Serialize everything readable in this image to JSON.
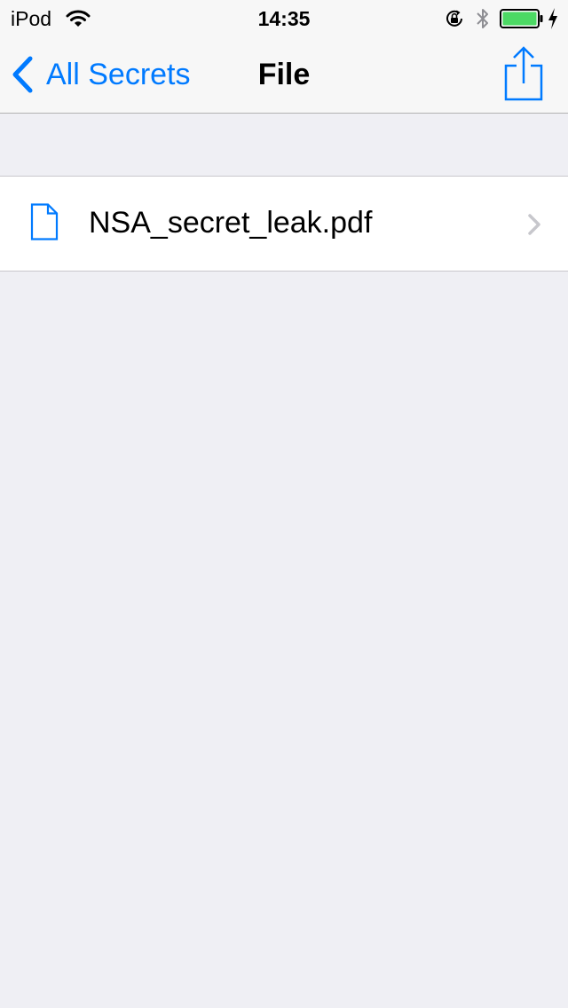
{
  "status_bar": {
    "carrier": "iPod",
    "time": "14:35",
    "icons": [
      "wifi-icon",
      "orientation-lock-icon",
      "bluetooth-icon",
      "battery-icon",
      "charging-icon"
    ],
    "battery_color": "#4cd964"
  },
  "nav": {
    "back_label": "All Secrets",
    "title": "File",
    "back_icon": "chevron-left-icon",
    "action_icon": "share-icon"
  },
  "files": [
    {
      "name": "NSA_secret_leak.pdf",
      "icon": "document-icon"
    }
  ],
  "colors": {
    "accent": "#007aff",
    "background": "#efeff4",
    "bar": "#f7f7f7",
    "separator": "#c8c7cc",
    "chevron": "#c7c7cc"
  }
}
